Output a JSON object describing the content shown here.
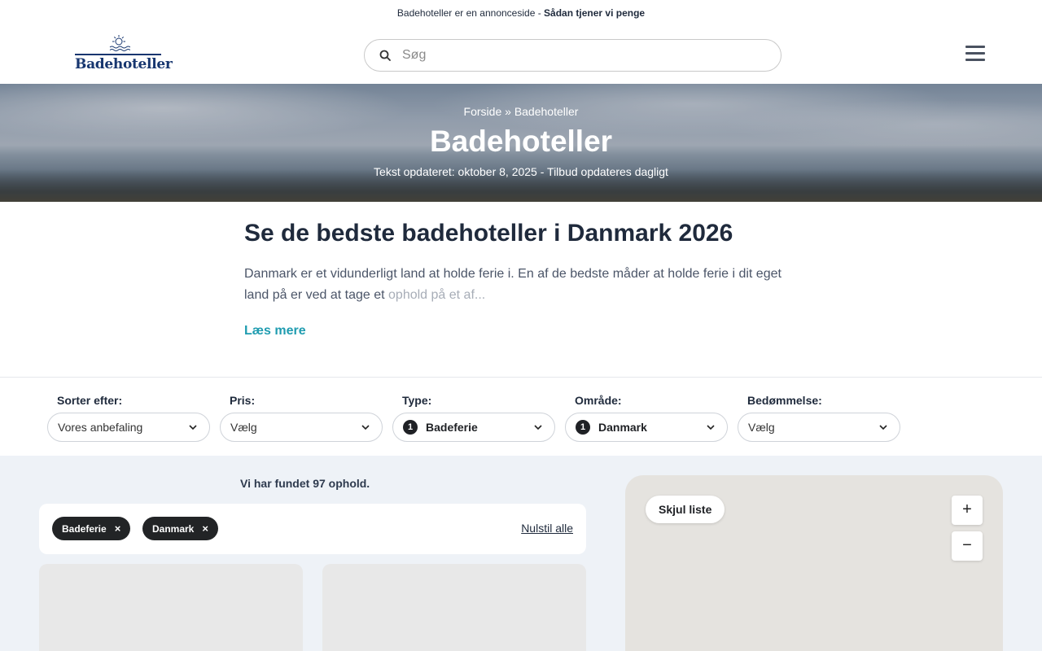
{
  "topbar": {
    "text": "Badehoteller er en annonceside -",
    "link": "Sådan tjener vi penge"
  },
  "header": {
    "logo_text": "Badehoteller",
    "search_placeholder": "Søg",
    "menu_icon": "hamburger-menu-icon"
  },
  "hero": {
    "breadcrumb": [
      "Forside",
      "Badehoteller"
    ],
    "breadcrumb_sep": "»",
    "title": "Badehoteller",
    "updated": "Tekst opdateret: oktober 8, 2025 - Tilbud opdateres dagligt"
  },
  "intro": {
    "heading": "Se de bedste badehoteller i Danmark 2026",
    "text_visible": "Danmark er et vidunderligt land at holde ferie i. En af de bedste måder at holde ferie i dit eget land på er ved at tage et",
    "text_faded": " ophold på et af...",
    "read_more": "Læs mere"
  },
  "filters": [
    {
      "label": "Sorter efter:",
      "value": "Vores anbefaling",
      "count": ""
    },
    {
      "label": "Pris:",
      "value": "Vælg",
      "count": ""
    },
    {
      "label": "Type:",
      "value": "Badeferie",
      "count": "1"
    },
    {
      "label": "Område:",
      "value": "Danmark",
      "count": "1"
    },
    {
      "label": "Bedømmelse:",
      "value": "Vælg",
      "count": ""
    }
  ],
  "results": {
    "found_text": "Vi har fundet 97 ophold.",
    "chips": [
      "Badeferie",
      "Danmark"
    ],
    "chip_remove": "×",
    "reset": "Nulstil alle"
  },
  "map": {
    "hide_list": "Skjul liste",
    "zoom_in": "+",
    "zoom_out": "−"
  }
}
